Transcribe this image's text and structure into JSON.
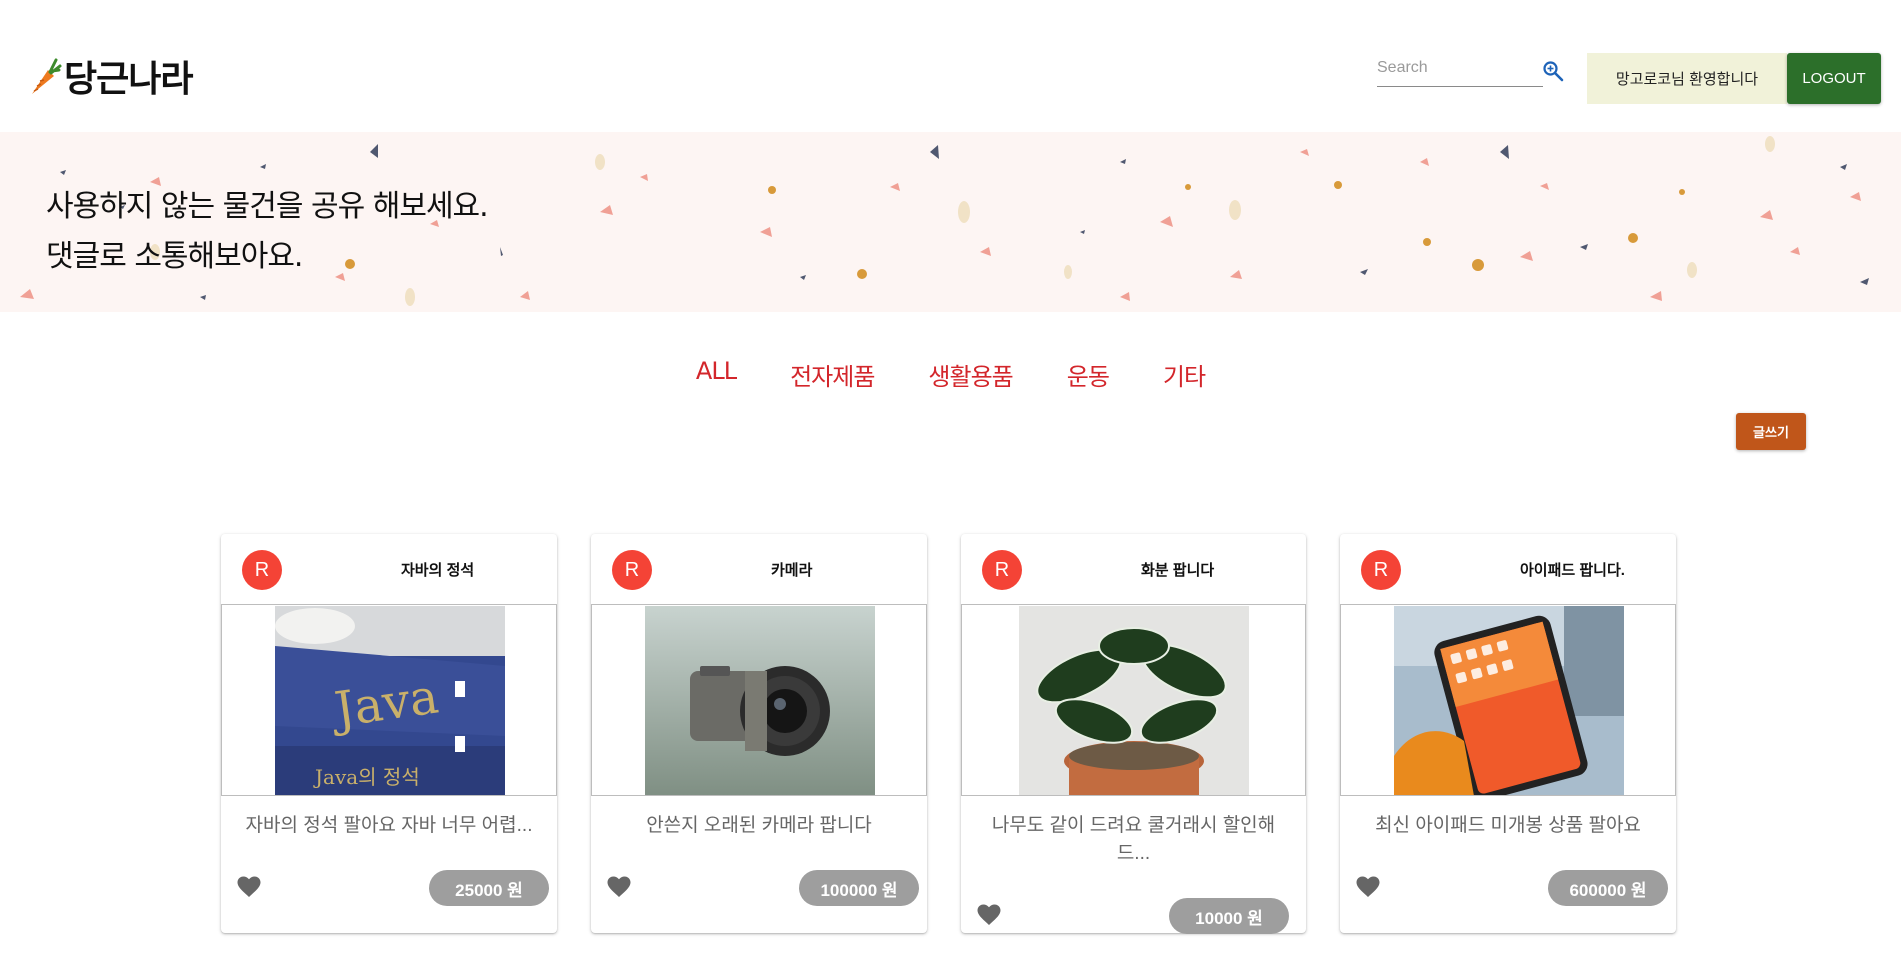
{
  "header": {
    "logo_text": "당근나라",
    "search_placeholder": "Search",
    "welcome": "망고로코님 환영합니다",
    "logout_label": "LOGOUT"
  },
  "banner": {
    "line1": "사용하지 않는 물건을 공유 해보세요.",
    "line2": "댓글로 소통해보아요."
  },
  "categories": [
    "ALL",
    "전자제품",
    "생활용품",
    "운동",
    "기타"
  ],
  "write_label": "글쓰기",
  "colors": {
    "logout_bg": "#2c6f2a",
    "welcome_bg": "#f1f2d9",
    "category_text": "#d3262b",
    "write_bg": "#c0561a",
    "avatar_bg": "#f44336",
    "price_bg": "#9e9e9e"
  },
  "posts": [
    {
      "avatar": "R",
      "title": "자바의 정석",
      "description": "자바의 정석 팔아요 자바 너무 어렵...",
      "price": "25000 원",
      "image": "java-book-photo"
    },
    {
      "avatar": "R",
      "title": "카메라",
      "description": "안쓴지 오래된 카메라 팝니다",
      "price": "100000 원",
      "image": "camera-photo"
    },
    {
      "avatar": "R",
      "title": "화분 팝니다",
      "description": "나무도 같이 드려요 쿨거래시 할인해 드...",
      "price": "10000 원",
      "image": "plant-photo"
    },
    {
      "avatar": "R",
      "title": "아이패드 팝니다.",
      "description": "최신 아이패드 미개봉 상품 팔아요",
      "price": "600000 원",
      "image": "ipad-photo"
    }
  ]
}
